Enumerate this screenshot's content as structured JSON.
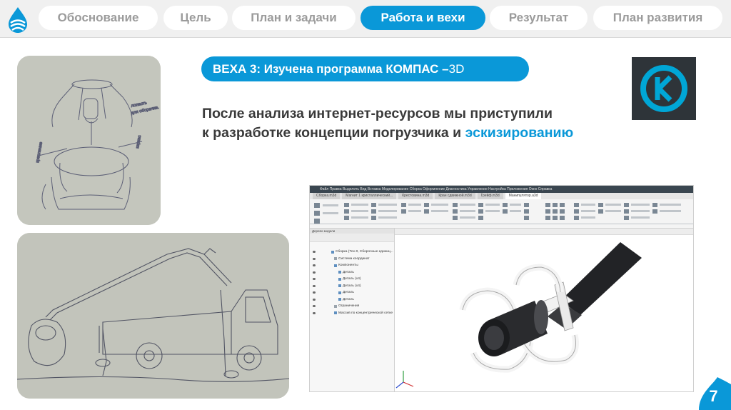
{
  "nav": {
    "tabs": [
      {
        "label": "Обоснование"
      },
      {
        "label": "Цель"
      },
      {
        "label": "План и задачи"
      },
      {
        "label": "Работа и вехи",
        "active": true
      },
      {
        "label": "Результат"
      },
      {
        "label": "План развития"
      }
    ]
  },
  "milestone": {
    "label_bold": "ВЕХА 3: Изучена программа КОМПАС –",
    "label_thin": " 3D"
  },
  "description": {
    "line1": "После анализа интернет-ресурсов мы приступили",
    "line2_prefix": "к разработке концепции погрузчика и ",
    "line2_highlight": "эскизированию"
  },
  "cad": {
    "menu_text": "Файл  Правка  Выделить  Вид  Вставка  Моделирование  Сборка  Оформление  Диагностика  Управление  Настройка  Приложения  Окно  Справка",
    "doc_tabs": [
      "Сборка.m3d",
      "Магнит 1 кристаллический...",
      "Крестовина.m3d",
      "Кран сдвижной.m3d",
      "Грейф.m3d",
      "Манипулятор.a3d"
    ],
    "tree_header": "Дерево модели",
    "tree": [
      "Сборка (Тех-0, Сборочные единиц...",
      "Система координат",
      "Компоненты",
      "Деталь",
      "Деталь (x4)",
      "Деталь (x4)",
      "Деталь",
      "Деталь",
      "Ограничения",
      "Массив по концентрической сетке"
    ]
  },
  "colors": {
    "accent": "#0a98d8",
    "inactive_tab_text": "#9b9b9b",
    "body_text": "#3a3a3a",
    "kompas_bg": "#2e3439",
    "kompas_ring": "#00a6d6"
  },
  "page": {
    "number": "7"
  }
}
